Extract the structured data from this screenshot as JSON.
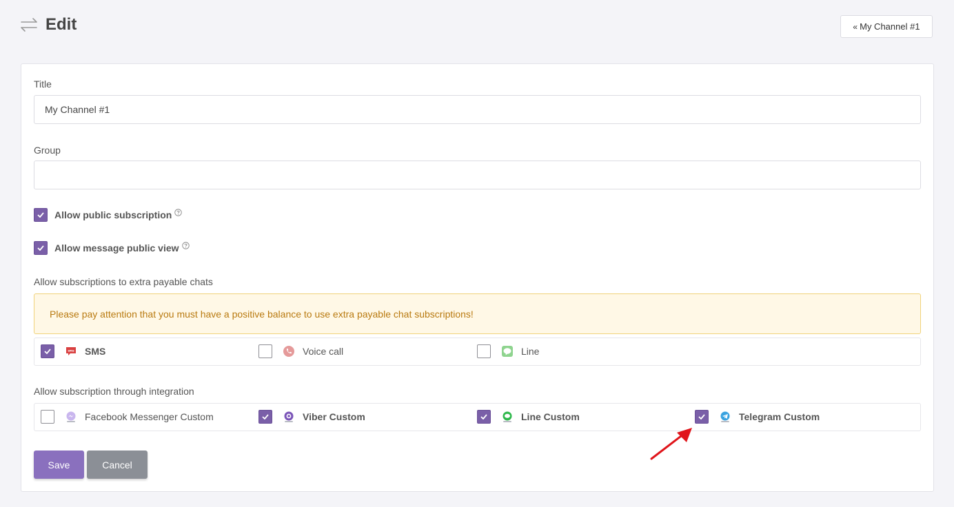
{
  "header": {
    "title": "Edit",
    "back_label": "My Channel #1"
  },
  "form": {
    "title_label": "Title",
    "title_value": "My Channel #1",
    "group_label": "Group",
    "group_value": "",
    "allow_public_subscription": {
      "label": "Allow public subscription",
      "checked": true
    },
    "allow_message_public_view": {
      "label": "Allow message public view",
      "checked": true
    },
    "extra_chats_label": "Allow subscriptions to extra payable chats",
    "alert_text": "Please pay attention that you must have a positive balance to use extra payable chat subscriptions!",
    "extra_chats": [
      {
        "label": "SMS",
        "checked": true,
        "icon": "sms-icon"
      },
      {
        "label": "Voice call",
        "checked": false,
        "icon": "phone-icon"
      },
      {
        "label": "Line",
        "checked": false,
        "icon": "line-icon"
      }
    ],
    "integration_label": "Allow subscription through integration",
    "integrations": [
      {
        "label": "Facebook Messenger Custom",
        "checked": false,
        "icon": "messenger-icon"
      },
      {
        "label": "Viber Custom",
        "checked": true,
        "icon": "viber-icon"
      },
      {
        "label": "Line Custom",
        "checked": true,
        "icon": "line-icon"
      },
      {
        "label": "Telegram Custom",
        "checked": true,
        "icon": "telegram-icon"
      }
    ]
  },
  "buttons": {
    "save_label": "Save",
    "cancel_label": "Cancel"
  },
  "colors": {
    "accent": "#7a5fa8",
    "save_button": "#8a70be",
    "cancel_button": "#8b8f96",
    "alert_text": "#b97a10",
    "alert_bg": "#fff8e6",
    "annotation_arrow": "#e0151b"
  }
}
